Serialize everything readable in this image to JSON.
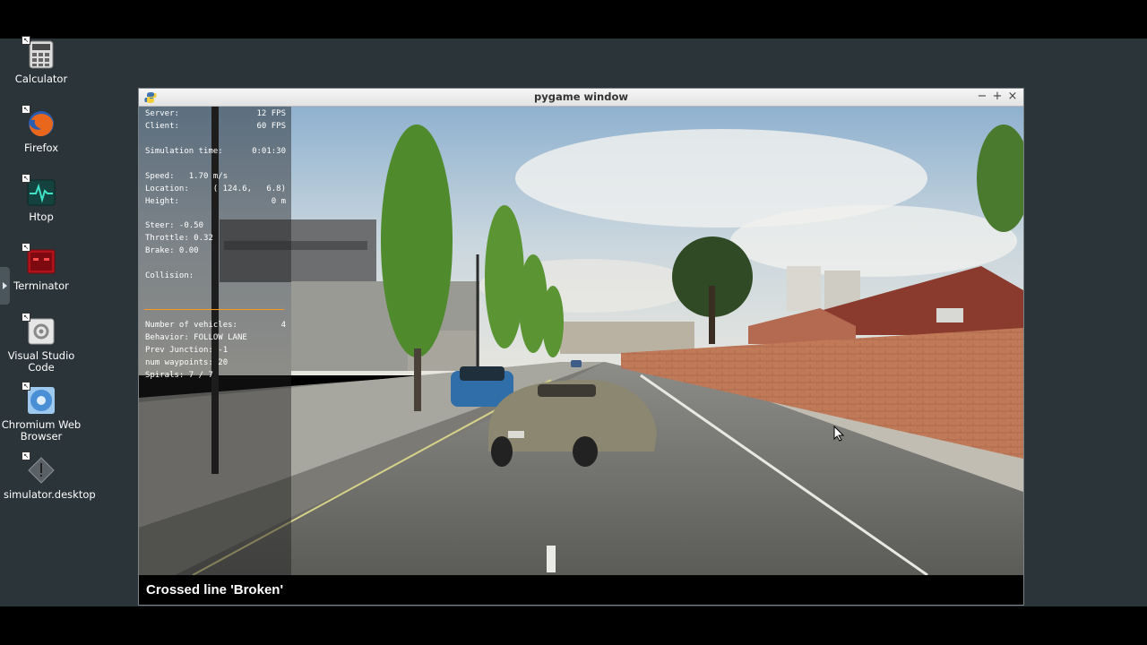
{
  "desktop": {
    "icons": [
      {
        "label": "Calculator",
        "icon": "calculator-icon"
      },
      {
        "label": "Firefox",
        "icon": "firefox-icon"
      },
      {
        "label": "Htop",
        "icon": "htop-icon"
      },
      {
        "label": "Terminator",
        "icon": "terminator-icon"
      },
      {
        "label": "Visual Studio Code",
        "icon": "vscode-icon"
      },
      {
        "label": "Chromium Web Browser",
        "icon": "chromium-icon"
      },
      {
        "label": "simulator.desktop",
        "icon": "desktop-file-icon"
      }
    ]
  },
  "window": {
    "title": "pygame window",
    "controls": {
      "minimize": "−",
      "maximize": "+",
      "close": "×"
    }
  },
  "hud": {
    "server_label": "Server:",
    "server_value": "12 FPS",
    "client_label": "Client:",
    "client_value": "60 FPS",
    "sim_time_label": "Simulation time:",
    "sim_time_value": "0:01:30",
    "speed": "Speed:   1.70 m/s",
    "location_label": "Location:",
    "location_value": "( 124.6,   6.8)",
    "height_label": "Height:",
    "height_value": "0 m",
    "steer": "Steer: -0.50",
    "throttle": "Throttle: 0.32",
    "brake": "Brake: 0.00",
    "collision": "Collision:",
    "vehicles_label": "Number of vehicles:",
    "vehicles_value": "4",
    "behavior": "Behavior: FOLLOW LANE",
    "prev_junction": "Prev Junction: -1",
    "waypoints": "num waypoints: 20",
    "spirals": "Spirals: 7 / 7",
    "separator_color": "#ff9a1f"
  },
  "notification": "Crossed line 'Broken'"
}
